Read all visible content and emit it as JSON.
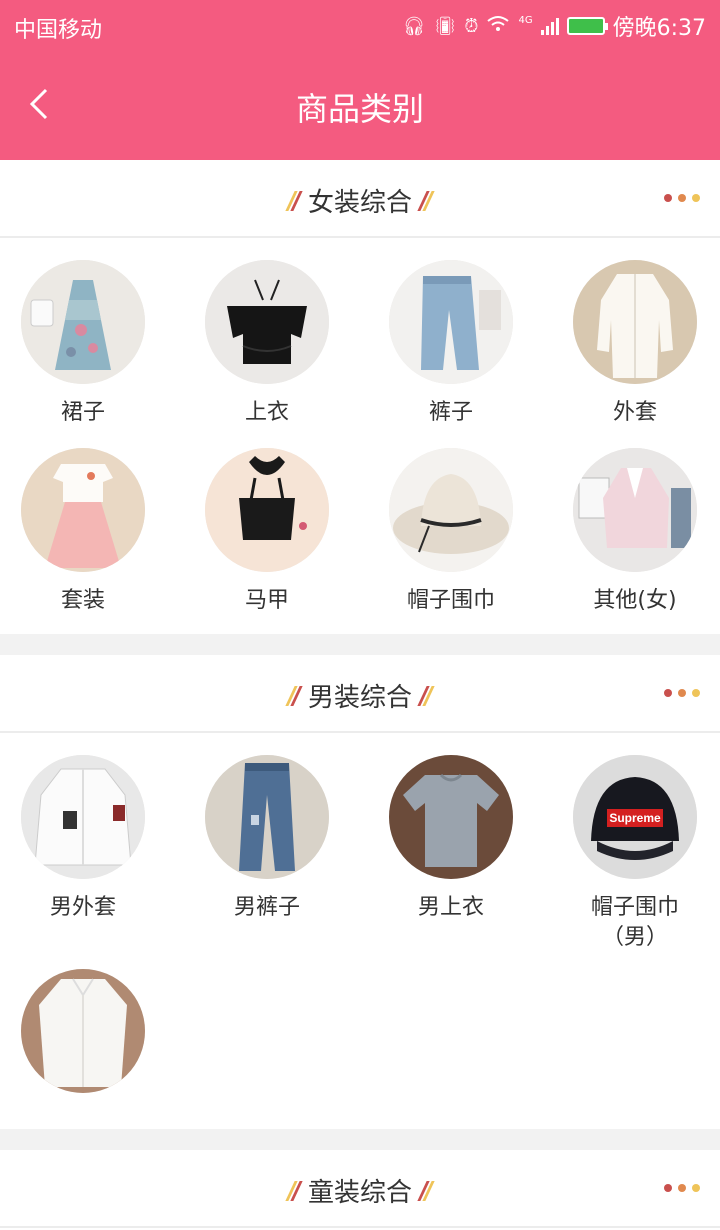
{
  "status": {
    "carrier": "中国移动",
    "time": "傍晚6:37",
    "network": "4G"
  },
  "header": {
    "title": "商品类别"
  },
  "sections": [
    {
      "title": "女装综合",
      "items": [
        {
          "label": "裙子",
          "icon": "dress-photo"
        },
        {
          "label": "上衣",
          "icon": "black-top-photo"
        },
        {
          "label": "裤子",
          "icon": "jeans-photo"
        },
        {
          "label": "外套",
          "icon": "cardigan-photo"
        },
        {
          "label": "套装",
          "icon": "outfit-set-photo"
        },
        {
          "label": "马甲",
          "icon": "vest-photo"
        },
        {
          "label": "帽子围巾",
          "icon": "sun-hat-photo"
        },
        {
          "label": "其他(女)",
          "icon": "other-women-photo"
        }
      ]
    },
    {
      "title": "男装综合",
      "items": [
        {
          "label": "男外套",
          "icon": "men-jacket-photo"
        },
        {
          "label": "男裤子",
          "icon": "men-jeans-photo"
        },
        {
          "label": "男上衣",
          "icon": "men-tshirt-photo"
        },
        {
          "label": "帽子围巾（男）",
          "icon": "cap-photo"
        },
        {
          "label": "",
          "icon": "white-shirt-photo"
        }
      ],
      "cap_text": "Supreme"
    },
    {
      "title": "童装综合"
    }
  ],
  "colors": {
    "brand": "#f45b80",
    "dot1": "#c9504d",
    "dot2": "#e0894e",
    "dot3": "#efc459"
  }
}
